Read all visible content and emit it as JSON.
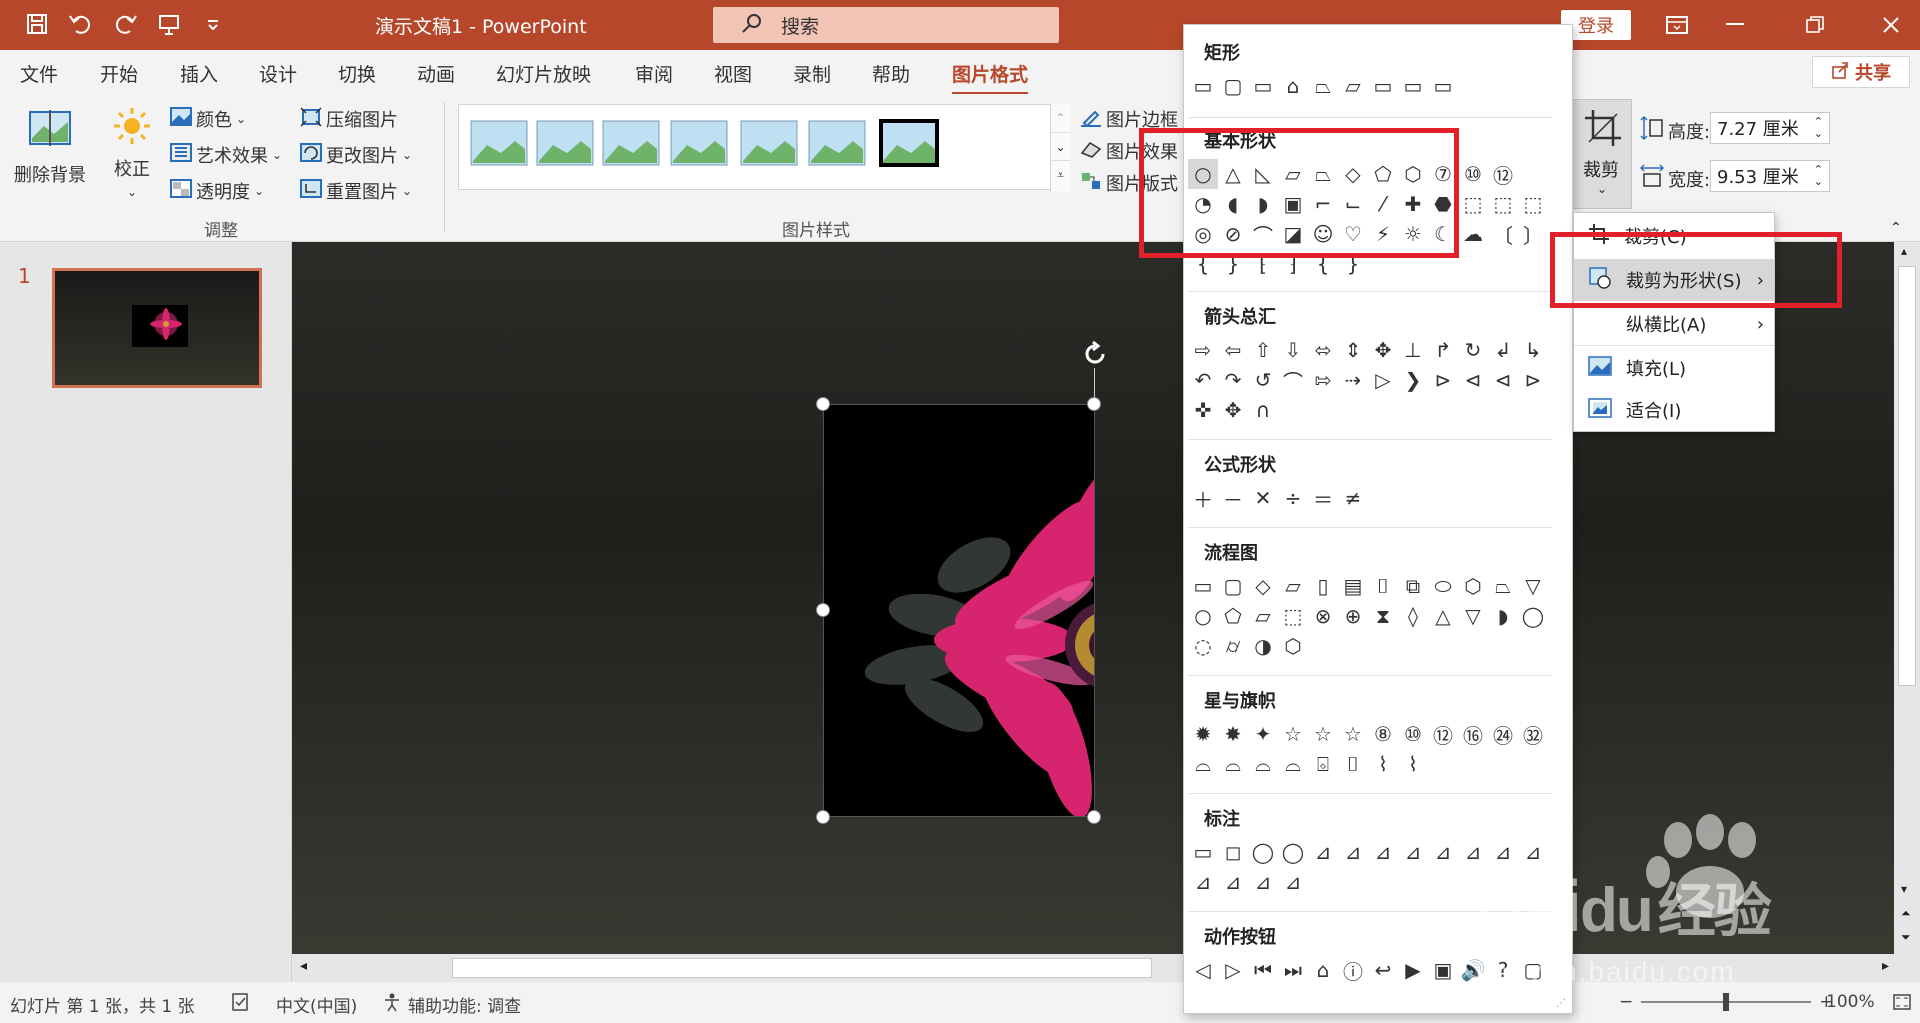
{
  "titlebar": {
    "doc_title": "演示文稿1  -  PowerPoint",
    "search_placeholder": "搜索",
    "login": "登录"
  },
  "tabs": [
    "文件",
    "开始",
    "插入",
    "设计",
    "切换",
    "动画",
    "幻灯片放映",
    "审阅",
    "视图",
    "录制",
    "帮助",
    "图片格式"
  ],
  "active_tab": "图片格式",
  "share": "共享",
  "ribbon": {
    "remove_bg": "删除背景",
    "corrections": "校正",
    "color": "颜色",
    "artistic": "艺术效果",
    "transparency": "透明度",
    "compress": "压缩图片",
    "change_pic": "更改图片",
    "reset_pic": "重置图片",
    "group_adjust": "调整",
    "group_styles": "图片样式",
    "pic_border": "图片边框",
    "pic_effects": "图片效果",
    "pic_layout": "图片版式",
    "crop": "裁剪",
    "height_label": "高度:",
    "height_value": "7.27 厘米",
    "width_label": "宽度:",
    "width_value": "9.53 厘米"
  },
  "thumbnails": {
    "slide_number": "1"
  },
  "statusbar": {
    "slide_info": "幻灯片 第 1 张，共 1 张",
    "language": "中文(中国)",
    "accessibility": "辅助功能: 调查",
    "zoom": "100%"
  },
  "shapes_panel": {
    "sections": {
      "rect": "矩形",
      "basic": "基本形状",
      "arrows": "箭头总汇",
      "equation": "公式形状",
      "flowchart": "流程图",
      "stars": "星与旗帜",
      "callouts": "标注",
      "actions": "动作按钮"
    },
    "number_badges": [
      "7",
      "10",
      "12",
      "8",
      "10",
      "12",
      "16",
      "24",
      "32"
    ]
  },
  "crop_menu": {
    "crop": "裁剪(C)",
    "crop_to_shape": "裁剪为形状(S)",
    "aspect_ratio": "纵横比(A)",
    "fill": "填充(L)",
    "fit": "适合(I)"
  },
  "watermark": {
    "brand": "Bai",
    "brand2": "du",
    "cn": "经验",
    "url": "jingyan.baidu.com"
  },
  "colors": {
    "accent": "#b7472a",
    "highlight_box": "#e2202a",
    "flower": "#d6246e"
  }
}
